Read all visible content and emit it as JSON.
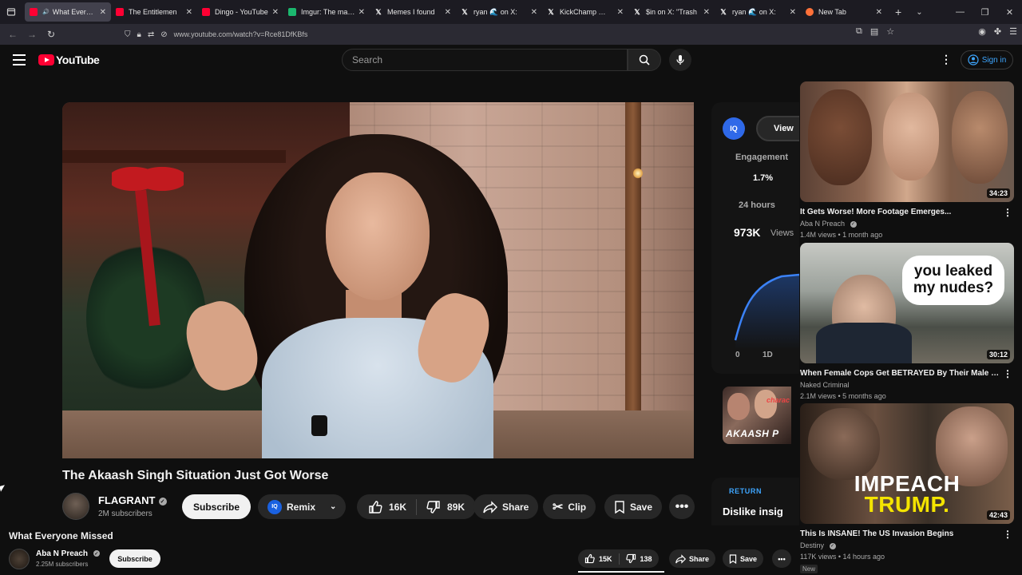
{
  "browser": {
    "tabs": [
      {
        "title": "What Everyone",
        "favicon": "youtube-favicon",
        "active": true
      },
      {
        "title": "The Entitlemen",
        "favicon": "youtube-favicon",
        "active": false
      },
      {
        "title": "Dingo - YouTube",
        "favicon": "youtube-favicon",
        "active": false
      },
      {
        "title": "Imgur: The magic o",
        "favicon": "imgur-favicon",
        "active": false
      },
      {
        "title": "Memes I found",
        "favicon": "x-favicon",
        "active": false
      },
      {
        "title": "ryan 🌊 on X:",
        "favicon": "x-favicon",
        "active": false
      },
      {
        "title": "KickChamp 👑 &",
        "favicon": "x-favicon",
        "active": false
      },
      {
        "title": "$in on X: \"Trash",
        "favicon": "x-favicon",
        "active": false
      },
      {
        "title": "ryan 🌊 on X:",
        "favicon": "x-favicon",
        "active": false
      },
      {
        "title": "New Tab",
        "favicon": "firefox-favicon",
        "active": false
      }
    ],
    "url": "www.youtube.com/watch?v=Rce81DfKBfs"
  },
  "masthead": {
    "logo_text": "YouTube",
    "search_placeholder": "Search",
    "sign_in": "Sign in"
  },
  "video": {
    "title": "The Akaash Singh Situation Just Got Worse",
    "channel": "FLAGRANT",
    "subscribers": "2M subscribers",
    "subscribe_label": "Subscribe",
    "remix_label": "Remix",
    "likes": "16K",
    "dislikes": "89K",
    "share_label": "Share",
    "clip_label": "Clip",
    "save_label": "Save"
  },
  "extension_panel": {
    "logo": "IQ",
    "view_label": "View",
    "engagement_label": "Engagement",
    "engagement_value": "1.7%",
    "period_label": "24 hours",
    "views_value": "973K",
    "views_label": "Views",
    "axis_start": "0",
    "axis_next": "1D",
    "thumb_caption": "AKAASH P",
    "thumb_caption_small": "charac",
    "return_label": "RETURN",
    "dislike_label": "Dislike insig"
  },
  "recommendations": [
    {
      "title": "It Gets Worse! More Footage Emerges...",
      "channel": "Aba N Preach",
      "meta": "1.4M views • 1 month ago",
      "duration": "34:23"
    },
    {
      "title": "When Female Cops Get BETRAYED By Their Male Partners",
      "channel": "Naked Criminal",
      "meta": "2.1M views • 5 months ago",
      "duration": "30:12",
      "thumb_text": "you leaked my nudes?"
    },
    {
      "title": "This Is INSANE! The US Invasion Begins",
      "channel": "Destiny",
      "meta": "117K views • 14 hours ago",
      "duration": "42:43",
      "thumb_text_1": "IMPEACH",
      "thumb_text_2": "TRUMP.",
      "badge": "New"
    }
  ],
  "mini": {
    "title": "What Everyone Missed",
    "channel": "Aba N Preach",
    "subscribers": "2.25M subscribers",
    "subscribe_label": "Subscribe",
    "likes": "15K",
    "dislikes": "138",
    "share_label": "Share",
    "save_label": "Save"
  },
  "colors": {
    "background": "#0f0f0f",
    "brand_red": "#ff0033",
    "link_blue": "#3ea6ff"
  }
}
